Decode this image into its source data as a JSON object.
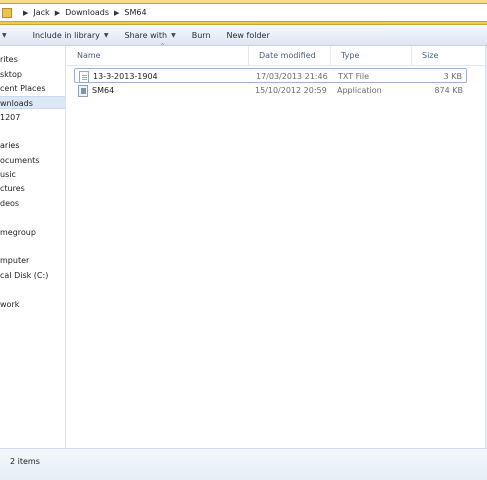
{
  "address": {
    "crumbs": [
      "Jack",
      "Downloads",
      "SM64"
    ]
  },
  "toolbar": {
    "include_in_library": "Include in library",
    "share_with": "Share with",
    "burn": "Burn",
    "new_folder": "New folder"
  },
  "nav": {
    "items": [
      {
        "label": "rites"
      },
      {
        "label": "sktop"
      },
      {
        "label": "cent Places"
      },
      {
        "label": "wnloads"
      },
      {
        "label": "1207"
      },
      {
        "label": "aries"
      },
      {
        "label": "ocuments"
      },
      {
        "label": "usic"
      },
      {
        "label": "ctures"
      },
      {
        "label": "deos"
      },
      {
        "label": "megroup"
      },
      {
        "label": "mputer"
      },
      {
        "label": "cal Disk (C:)"
      },
      {
        "label": "work"
      }
    ]
  },
  "columns": {
    "name": "Name",
    "date_modified": "Date modified",
    "type": "Type",
    "size": "Size",
    "sort_indicator": "^"
  },
  "files": [
    {
      "name": "13-3-2013-1904",
      "date": "17/03/2013 21:46",
      "type": "TXT File",
      "size": "3 KB",
      "icon": "text-file-icon"
    },
    {
      "name": "SM64",
      "date": "15/10/2012 20:59",
      "type": "Application",
      "size": "874 KB",
      "icon": "application-icon"
    }
  ],
  "status": {
    "count": "2 items"
  },
  "colors": {
    "title_bar": "#f2c94c",
    "command_bar": "#dbe6f3",
    "selection": "#dde8f6"
  }
}
